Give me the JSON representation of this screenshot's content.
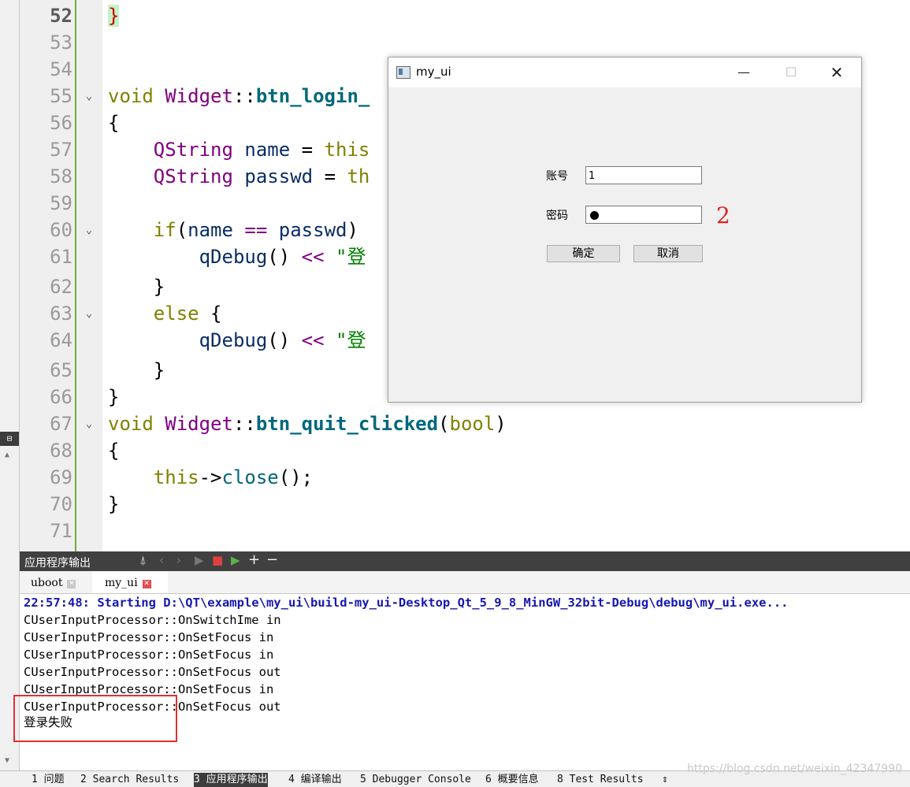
{
  "editor": {
    "lines": [
      {
        "n": "52",
        "fold": "",
        "current": true
      },
      {
        "n": "53",
        "fold": ""
      },
      {
        "n": "54",
        "fold": ""
      },
      {
        "n": "55",
        "fold": "⌄"
      },
      {
        "n": "56",
        "fold": ""
      },
      {
        "n": "57",
        "fold": ""
      },
      {
        "n": "58",
        "fold": ""
      },
      {
        "n": "59",
        "fold": ""
      },
      {
        "n": "60",
        "fold": "⌄"
      },
      {
        "n": "61",
        "fold": ""
      },
      {
        "n": "62",
        "fold": ""
      },
      {
        "n": "63",
        "fold": "⌄"
      },
      {
        "n": "64",
        "fold": ""
      },
      {
        "n": "65",
        "fold": ""
      },
      {
        "n": "66",
        "fold": ""
      },
      {
        "n": "67",
        "fold": "⌄"
      },
      {
        "n": "68",
        "fold": ""
      },
      {
        "n": "69",
        "fold": ""
      },
      {
        "n": "70",
        "fold": ""
      },
      {
        "n": "71",
        "fold": ""
      }
    ],
    "code": {
      "l52": "}",
      "l55_void": "void",
      "l55_class": "Widget",
      "l55_sep": "::",
      "l55_fn": "btn_login_",
      "l56": "{",
      "l57_type": "QString",
      "l57_var": "name",
      "l57_eq": "=",
      "l57_this": "this",
      "l58_type": "QString",
      "l58_var": "passwd",
      "l58_eq": "=",
      "l58_this": "th",
      "l60_if": "if",
      "l60_open": "(",
      "l60_a": "name",
      "l60_op": "==",
      "l60_b": "passwd",
      "l60_close": ")",
      "l61_fn": "qDebug",
      "l61_paren": "()",
      "l61_op": "<<",
      "l61_str": "\"登",
      "l62": "}",
      "l63_else": "else",
      "l63_brace": "{",
      "l64_fn": "qDebug",
      "l64_paren": "()",
      "l64_op": "<<",
      "l64_str": "\"登",
      "l65": "}",
      "l66": "}",
      "l67_void": "void",
      "l67_class": "Widget",
      "l67_sep": "::",
      "l67_fn": "btn_quit_clicked",
      "l67_open": "(",
      "l67_arg": "bool",
      "l67_close": ")",
      "l68": "{",
      "l69_this": "this",
      "l69_arrow": "->",
      "l69_fn": "close",
      "l69_rest": "();",
      "l70": "}"
    }
  },
  "dialog": {
    "title": "my_ui",
    "minimize": "—",
    "maximize": "☐",
    "close": "✕",
    "account_label": "账号",
    "account_value": "1",
    "password_label": "密码",
    "ok_label": "确定",
    "cancel_label": "取消",
    "annotation": "2"
  },
  "output_pane": {
    "title": "应用程序输出",
    "tools": [
      "⍋",
      "‹",
      "›",
      "▶",
      "■",
      "▶",
      "+",
      "−"
    ],
    "tabs": [
      {
        "label": "uboot",
        "close": "✕"
      },
      {
        "label": "my_ui",
        "close": "✕"
      }
    ],
    "lines": [
      "22:57:48: Starting D:\\QT\\example\\my_ui\\build-my_ui-Desktop_Qt_5_9_8_MinGW_32bit-Debug\\debug\\my_ui.exe...",
      "CUserInputProcessor::OnSwitchIme in",
      "CUserInputProcessor::OnSetFocus in",
      "CUserInputProcessor::OnSetFocus in",
      "CUserInputProcessor::OnSetFocus out",
      "CUserInputProcessor::OnSetFocus in",
      "CUserInputProcessor::OnSetFocus out",
      "登录失败"
    ]
  },
  "statusbar": {
    "items": [
      "1 问题",
      "2 Search Results",
      "3 应用程序输出",
      "4 编译输出",
      "5 Debugger Console",
      "6 概要信息",
      "8 Test Results",
      "⇕"
    ],
    "watermark": "https://blog.csdn.net/weixin_42347990"
  },
  "colors": {
    "keyword": "#808000",
    "type": "#800080",
    "function": "#00677c",
    "string": "#008000",
    "highlight_box": "#e03030",
    "active_marker": "#6fae3a"
  }
}
